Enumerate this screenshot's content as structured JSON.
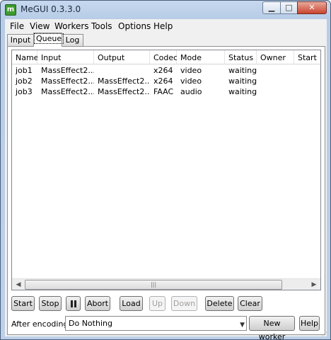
{
  "window": {
    "title": "MeGUI 0.3.3.0",
    "icon_letter": "m"
  },
  "menu": {
    "items": [
      "File",
      "View",
      "Workers",
      "Tools",
      "Options",
      "Help"
    ]
  },
  "tabs": [
    "Input",
    "Queue",
    "Log"
  ],
  "active_tab": "Queue",
  "queue": {
    "columns": [
      "Name",
      "Input",
      "Output",
      "Codec",
      "Mode",
      "Status",
      "Owner",
      "Start"
    ],
    "rows": [
      {
        "name": "job1",
        "input": "MassEffect2....",
        "output": "",
        "codec": "x264",
        "mode": "video",
        "status": "waiting",
        "owner": "",
        "start": ""
      },
      {
        "name": "job2",
        "input": "MassEffect2....",
        "output": "MassEffect2....",
        "codec": "x264",
        "mode": "video",
        "status": "waiting",
        "owner": "",
        "start": ""
      },
      {
        "name": "job3",
        "input": "MassEffect2....",
        "output": "MassEffect2....",
        "codec": "FAAC",
        "mode": "audio",
        "status": "waiting",
        "owner": "",
        "start": ""
      }
    ]
  },
  "buttons": {
    "start": "Start",
    "stop": "Stop",
    "abort": "Abort",
    "load": "Load",
    "up": "Up",
    "down": "Down",
    "delete": "Delete",
    "clear": "Clear",
    "new_worker": "New worker",
    "help": "Help"
  },
  "after_encoding": {
    "label": "After encoding:",
    "value": "Do Nothing"
  },
  "icons": [
    "app-icon",
    "minimize-icon",
    "maximize-icon",
    "close-icon",
    "pause-icon",
    "scroll-left-icon",
    "scroll-right-icon",
    "dropdown-arrow-icon"
  ]
}
